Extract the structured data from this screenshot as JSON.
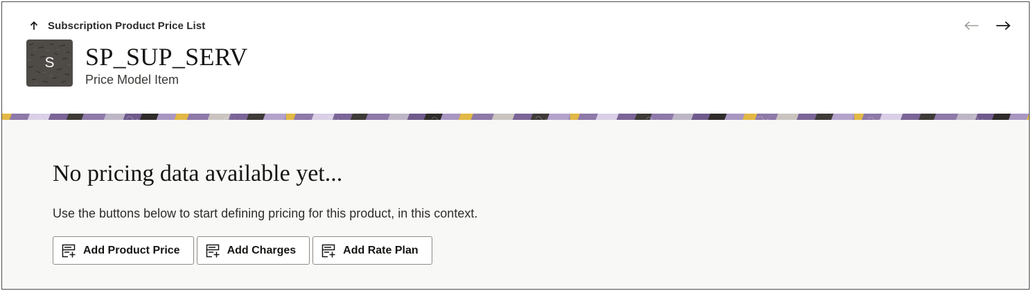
{
  "header": {
    "back_link_label": "Subscription Product Price List",
    "avatar_letter": "S",
    "title": "SP_SUP_SERV",
    "subtitle": "Price Model Item"
  },
  "empty_state": {
    "heading": "No pricing data available yet...",
    "description": "Use the buttons below to start defining pricing for this product, in this context."
  },
  "actions": {
    "add_product_price": "Add Product Price",
    "add_charges": "Add Charges",
    "add_rate_plan": "Add Rate Plan"
  },
  "colors": {
    "banner_purple": "#8e79a8",
    "banner_yellow": "#e2b846",
    "banner_dark": "#3d3a38",
    "avatar_bg": "#4e4b47",
    "content_bg": "#f8f8f7"
  },
  "icons": {
    "back": "arrow-up-icon",
    "previous": "arrow-left-icon",
    "next": "arrow-right-icon",
    "add": "add-list-icon"
  }
}
